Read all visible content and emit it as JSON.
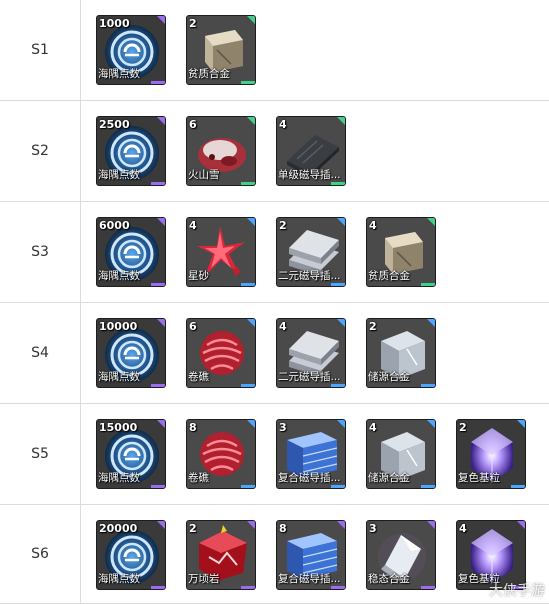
{
  "rows": [
    {
      "label": "S1",
      "items": [
        {
          "count": "1000",
          "name": "海隅点数",
          "rarity": "purple",
          "icon": "currency-emblem-icon"
        },
        {
          "count": "2",
          "name": "贫质合金",
          "rarity": "green",
          "icon": "alloy-ingot-icon"
        }
      ]
    },
    {
      "label": "S2",
      "items": [
        {
          "count": "2500",
          "name": "海隅点数",
          "rarity": "purple",
          "icon": "currency-emblem-icon"
        },
        {
          "count": "6",
          "name": "火山雪",
          "rarity": "green",
          "icon": "volcanic-rock-icon"
        },
        {
          "count": "4",
          "name": "单级磁导插...",
          "rarity": "green",
          "icon": "magnetic-plate-icon"
        }
      ]
    },
    {
      "label": "S3",
      "items": [
        {
          "count": "6000",
          "name": "海隅点数",
          "rarity": "purple",
          "icon": "currency-emblem-icon"
        },
        {
          "count": "4",
          "name": "星砂",
          "rarity": "blue",
          "icon": "star-sand-icon"
        },
        {
          "count": "2",
          "name": "二元磁导插...",
          "rarity": "blue",
          "icon": "metal-stack-icon"
        },
        {
          "count": "4",
          "name": "贫质合金",
          "rarity": "green",
          "icon": "alloy-ingot-icon"
        }
      ]
    },
    {
      "label": "S4",
      "items": [
        {
          "count": "10000",
          "name": "海隅点数",
          "rarity": "purple",
          "icon": "currency-emblem-icon"
        },
        {
          "count": "6",
          "name": "卷礁",
          "rarity": "blue",
          "icon": "red-reef-icon"
        },
        {
          "count": "4",
          "name": "二元磁导插...",
          "rarity": "blue",
          "icon": "metal-stack-icon"
        },
        {
          "count": "2",
          "name": "储源合金",
          "rarity": "blue",
          "icon": "metal-cube-icon"
        }
      ]
    },
    {
      "label": "S5",
      "items": [
        {
          "count": "15000",
          "name": "海隅点数",
          "rarity": "purple",
          "icon": "currency-emblem-icon"
        },
        {
          "count": "8",
          "name": "卷礁",
          "rarity": "blue",
          "icon": "red-reef-icon"
        },
        {
          "count": "3",
          "name": "复合磁导插...",
          "rarity": "blue",
          "icon": "blue-plate-stack-icon"
        },
        {
          "count": "4",
          "name": "储源合金",
          "rarity": "blue",
          "icon": "metal-cube-icon"
        },
        {
          "count": "2",
          "name": "复色基粒",
          "rarity": "blue",
          "icon": "purple-crystal-icon"
        }
      ]
    },
    {
      "label": "S6",
      "items": [
        {
          "count": "20000",
          "name": "海隅点数",
          "rarity": "purple",
          "icon": "currency-emblem-icon"
        },
        {
          "count": "2",
          "name": "万顷岩",
          "rarity": "purple",
          "icon": "red-crystal-rock-icon"
        },
        {
          "count": "8",
          "name": "复合磁导插...",
          "rarity": "purple",
          "icon": "blue-plate-stack-icon"
        },
        {
          "count": "3",
          "name": "稳态合金",
          "rarity": "purple",
          "icon": "silver-ingot-icon"
        },
        {
          "count": "4",
          "name": "复色基粒",
          "rarity": "purple",
          "icon": "purple-crystal-icon"
        }
      ]
    }
  ],
  "watermark": "大侠手游",
  "colors": {
    "purple": "#9b6cf0",
    "green": "#3fd08a",
    "blue": "#4aa6ff",
    "yellow": "#f0d020"
  }
}
